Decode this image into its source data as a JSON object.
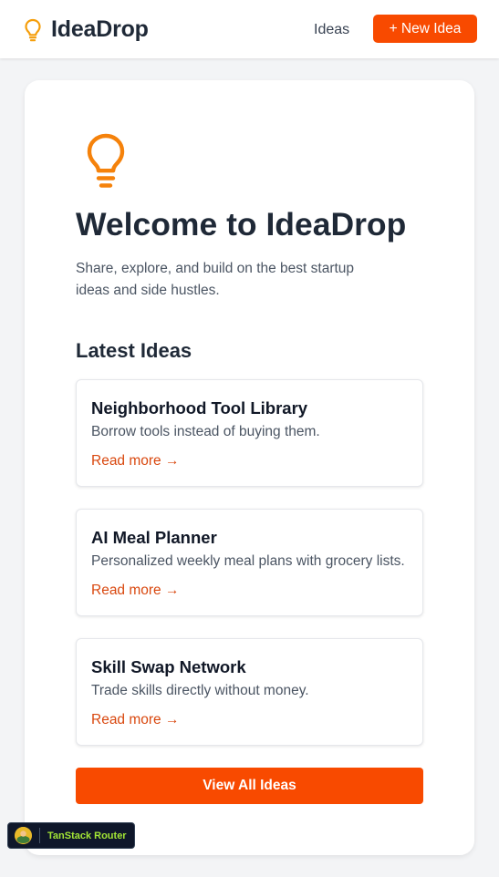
{
  "header": {
    "brand_name": "IdeaDrop",
    "nav_ideas": "Ideas",
    "new_idea_label": "+ New Idea"
  },
  "hero": {
    "title": "Welcome to IdeaDrop",
    "subtitle": "Share, explore, and build on the best startup ideas and side hustles."
  },
  "latest": {
    "heading": "Latest Ideas",
    "items": [
      {
        "title": "Neighborhood Tool Library",
        "description": "Borrow tools instead of buying them.",
        "link": "Read more →"
      },
      {
        "title": "AI Meal Planner",
        "description": "Personalized weekly meal plans with grocery lists.",
        "link": "Read more →"
      },
      {
        "title": "Skill Swap Network",
        "description": "Trade skills directly without money.",
        "link": "Read more →"
      }
    ],
    "view_all_label": "View All Ideas"
  },
  "devtools": {
    "label": "TanStack Router"
  },
  "icons": {
    "brand": "lightbulb-icon",
    "hero": "lightbulb-icon"
  },
  "colors": {
    "accent": "#f84a00",
    "link": "#d9480f",
    "icon": "#f59e0b",
    "background": "#f3f4f6"
  }
}
